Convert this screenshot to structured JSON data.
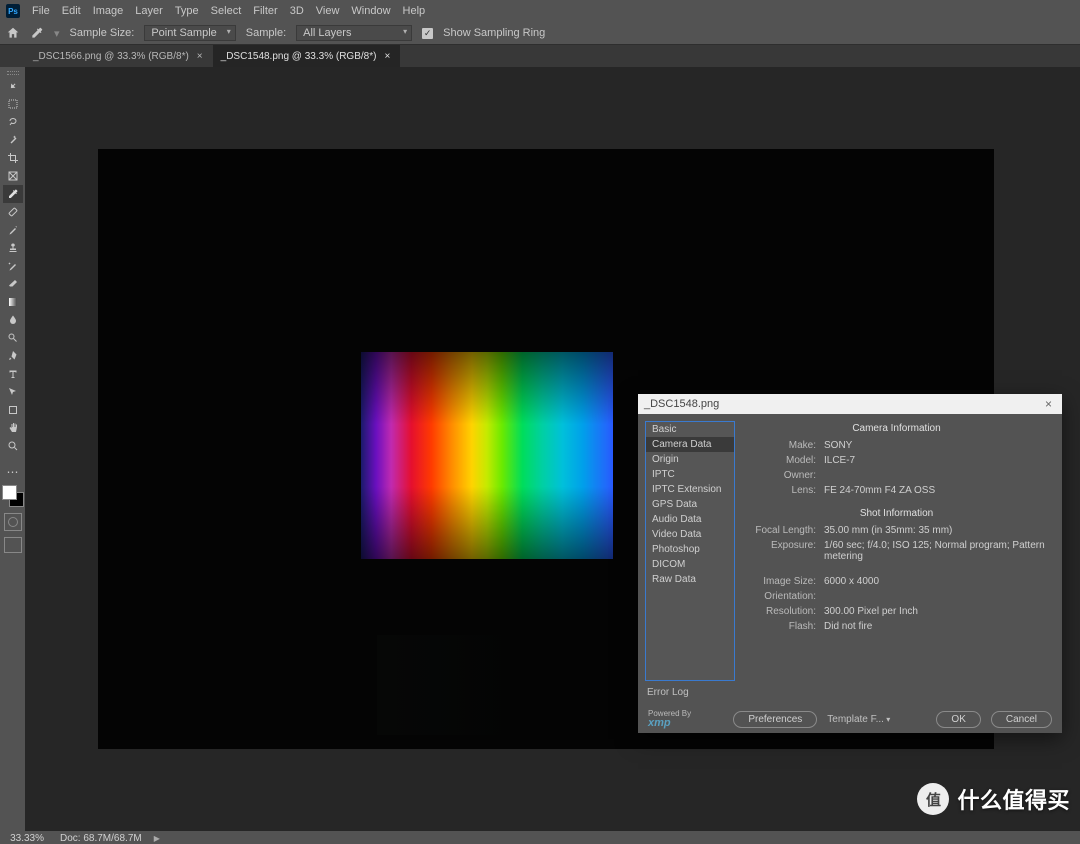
{
  "menu": {
    "items": [
      "File",
      "Edit",
      "Image",
      "Layer",
      "Type",
      "Select",
      "Filter",
      "3D",
      "View",
      "Window",
      "Help"
    ]
  },
  "options": {
    "sample_size_label": "Sample Size:",
    "sample_size_value": "Point Sample",
    "sample_label": "Sample:",
    "sample_value": "All Layers",
    "show_ring_label": "Show Sampling Ring"
  },
  "tabs": [
    {
      "label": "_DSC1566.png @ 33.3% (RGB/8*)",
      "active": false
    },
    {
      "label": "_DSC1548.png @ 33.3% (RGB/8*)",
      "active": true
    }
  ],
  "status": {
    "zoom": "33.33%",
    "docsize": "Doc: 68.7M/68.7M"
  },
  "dialog": {
    "title": "_DSC1548.png",
    "categories": [
      "Basic",
      "Camera Data",
      "Origin",
      "IPTC",
      "IPTC Extension",
      "GPS Data",
      "Audio Data",
      "Video Data",
      "Photoshop",
      "DICOM",
      "Raw Data"
    ],
    "selected": "Camera Data",
    "error_log": "Error Log",
    "powered_by": "Powered By",
    "xmp": "xmp",
    "preferences": "Preferences",
    "template": "Template F...",
    "ok": "OK",
    "cancel": "Cancel",
    "section_camera": "Camera Information",
    "section_shot": "Shot Information",
    "fields": {
      "make_l": "Make:",
      "make_v": "SONY",
      "model_l": "Model:",
      "model_v": "ILCE-7",
      "owner_l": "Owner:",
      "owner_v": "",
      "lens_l": "Lens:",
      "lens_v": "FE 24-70mm F4 ZA OSS",
      "focal_l": "Focal Length:",
      "focal_v": "35.00 mm  (in 35mm: 35 mm)",
      "expo_l": "Exposure:",
      "expo_v": "1/60 sec;  f/4.0;  ISO 125;  Normal program;  Pattern metering",
      "size_l": "Image Size:",
      "size_v": "6000 x 4000",
      "orient_l": "Orientation:",
      "orient_v": "",
      "reso_l": "Resolution:",
      "reso_v": "300.00 Pixel per Inch",
      "flash_l": "Flash:",
      "flash_v": "Did not fire"
    }
  },
  "watermark": {
    "badge": "值",
    "text": "什么值得买"
  }
}
